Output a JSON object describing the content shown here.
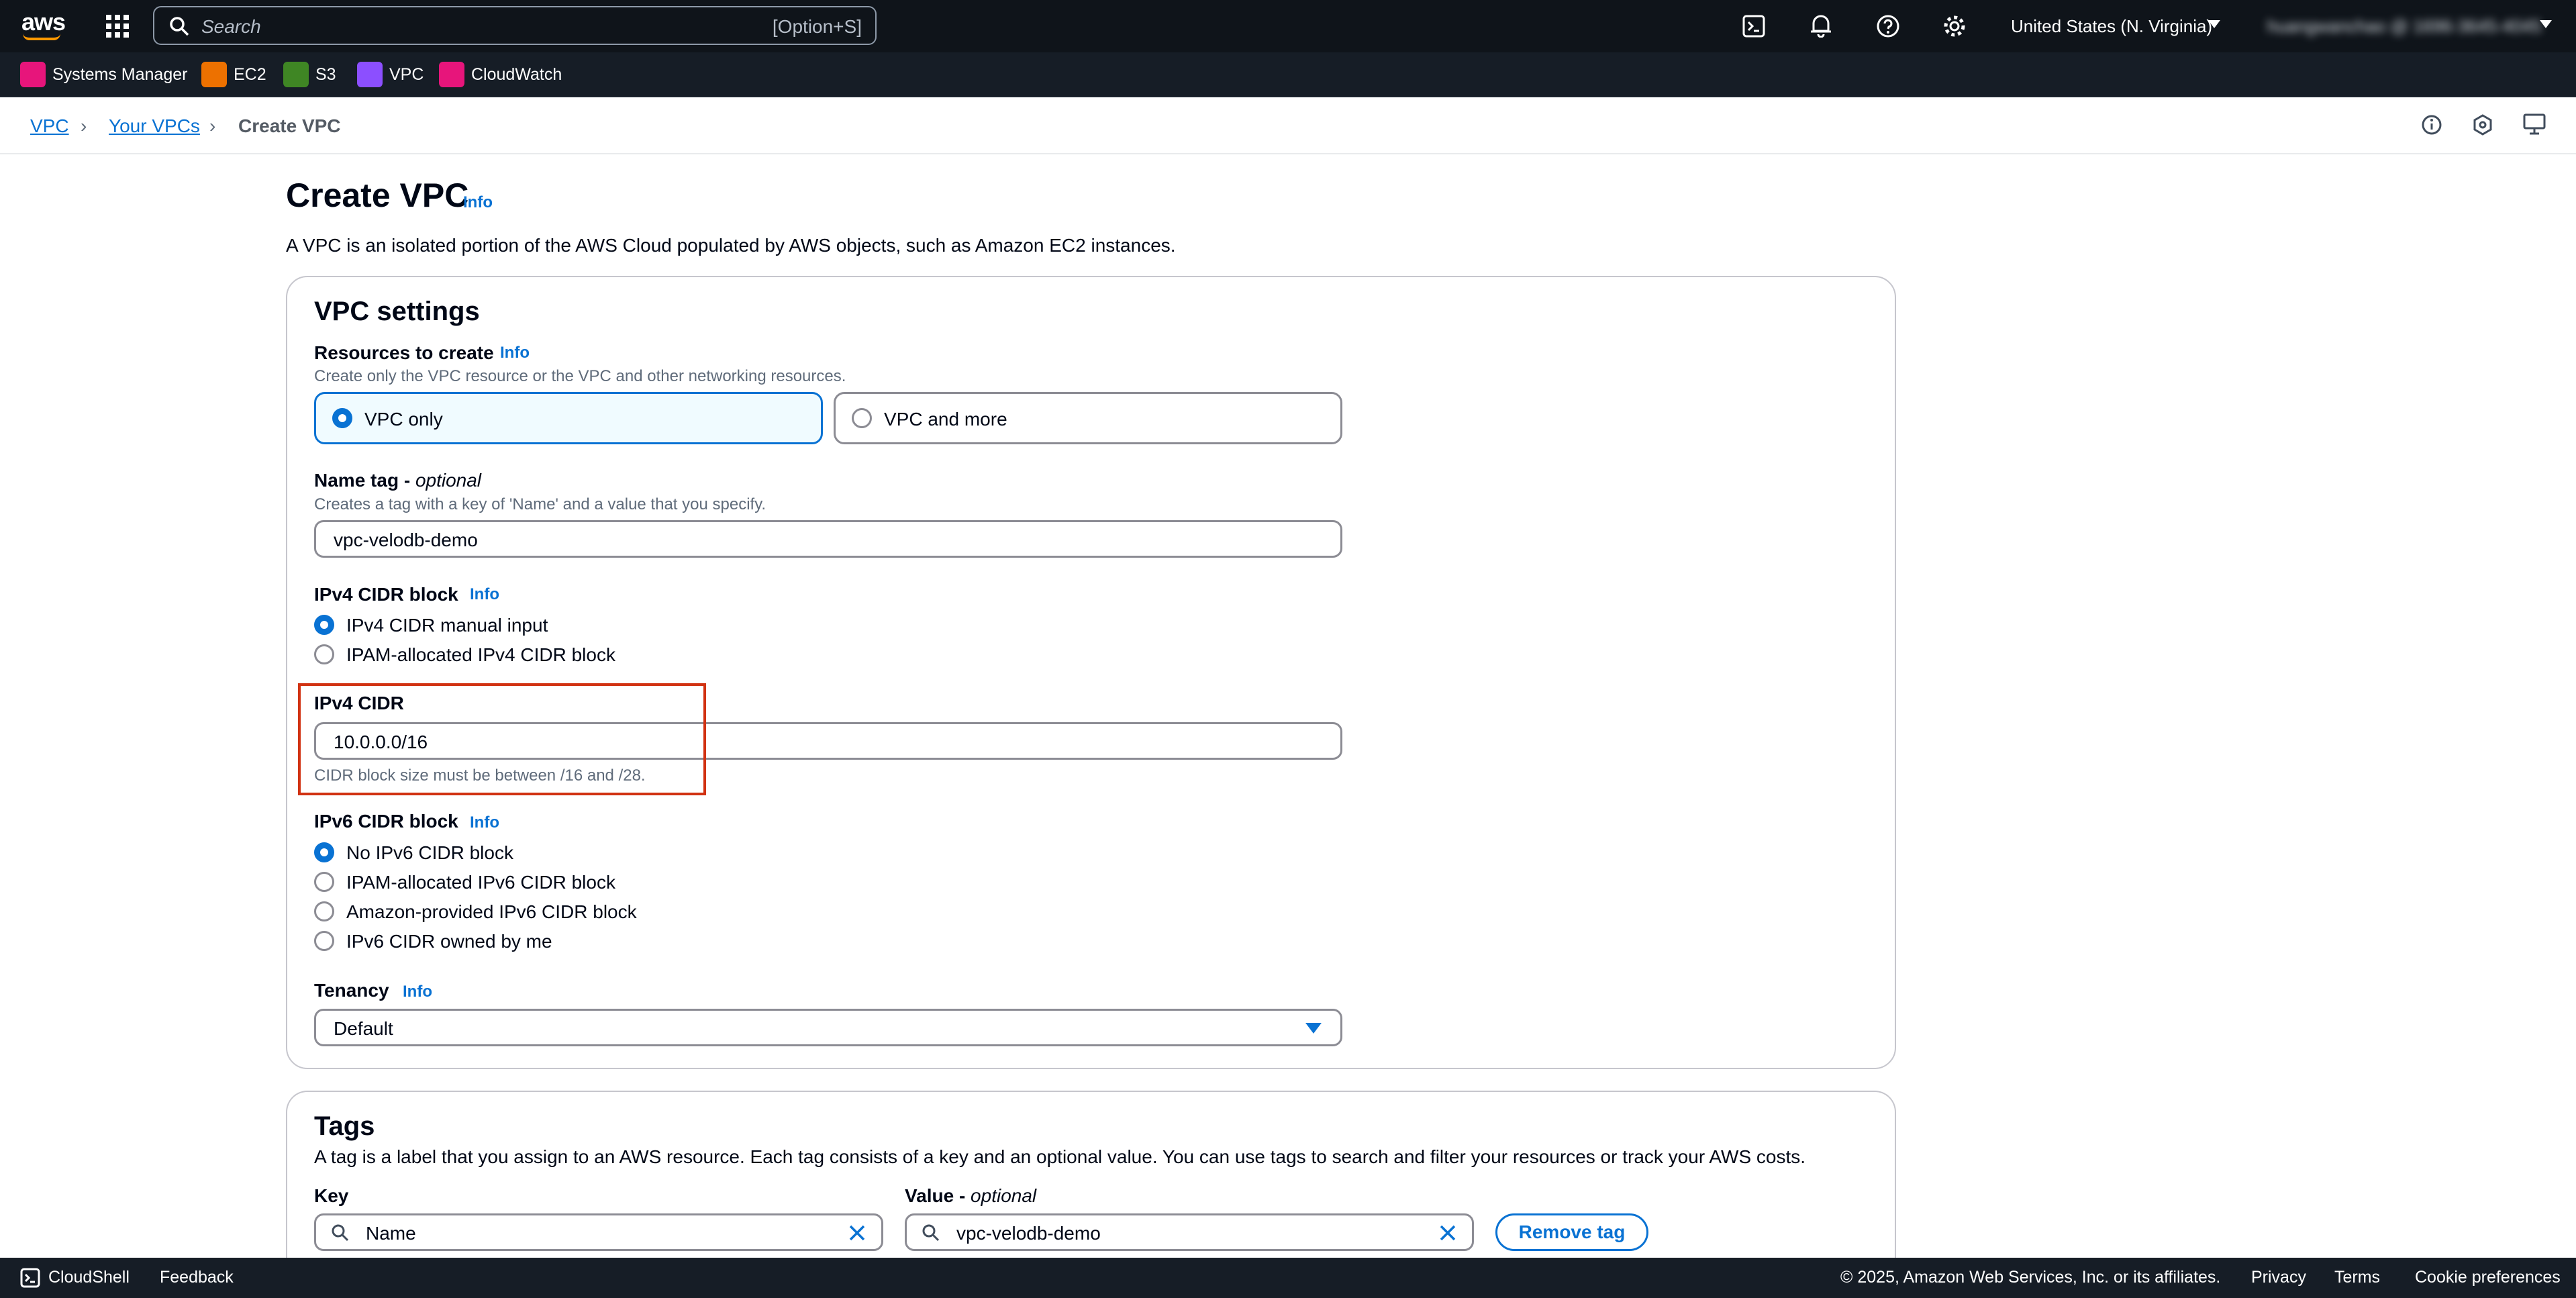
{
  "topnav": {
    "logo": "aws",
    "search_placeholder": "Search",
    "search_shortcut": "[Option+S]",
    "region": "United States (N. Virginia)",
    "account": "huangwanchao @ 1696-3645-4045"
  },
  "services": [
    {
      "label": "Systems Manager",
      "color": "#e7157b"
    },
    {
      "label": "EC2",
      "color": "#ed7100"
    },
    {
      "label": "S3",
      "color": "#3f8624"
    },
    {
      "label": "VPC",
      "color": "#8c4fff"
    },
    {
      "label": "CloudWatch",
      "color": "#e7157b"
    }
  ],
  "breadcrumb": {
    "vpc": "VPC",
    "your_vpcs": "Your VPCs",
    "current": "Create VPC"
  },
  "page": {
    "title": "Create VPC",
    "info": "Info",
    "description": "A VPC is an isolated portion of the AWS Cloud populated by AWS objects, such as Amazon EC2 instances."
  },
  "vpc_settings": {
    "heading": "VPC settings",
    "resources": {
      "label": "Resources to create",
      "info": "Info",
      "hint": "Create only the VPC resource or the VPC and other networking resources.",
      "options": [
        "VPC only",
        "VPC and more"
      ],
      "selected": "VPC only"
    },
    "name_tag": {
      "label": "Name tag - ",
      "optional": "optional",
      "hint": "Creates a tag with a key of 'Name' and a value that you specify.",
      "value": "vpc-velodb-demo"
    },
    "ipv4_block": {
      "label": "IPv4 CIDR block",
      "info": "Info",
      "options": [
        "IPv4 CIDR manual input",
        "IPAM-allocated IPv4 CIDR block"
      ],
      "selected": "IPv4 CIDR manual input"
    },
    "ipv4_cidr": {
      "label": "IPv4 CIDR",
      "value": "10.0.0.0/16",
      "hint": "CIDR block size must be between /16 and /28."
    },
    "ipv6_block": {
      "label": "IPv6 CIDR block",
      "info": "Info",
      "options": [
        "No IPv6 CIDR block",
        "IPAM-allocated IPv6 CIDR block",
        "Amazon-provided IPv6 CIDR block",
        "IPv6 CIDR owned by me"
      ],
      "selected": "No IPv6 CIDR block"
    },
    "tenancy": {
      "label": "Tenancy",
      "info": "Info",
      "value": "Default"
    }
  },
  "tags": {
    "heading": "Tags",
    "description": "A tag is a label that you assign to an AWS resource. Each tag consists of a key and an optional value. You can use tags to search and filter your resources or track your AWS costs.",
    "key_label": "Key",
    "value_label": "Value - ",
    "value_optional": "optional",
    "key_value": "Name",
    "value_value": "vpc-velodb-demo",
    "remove_label": "Remove tag"
  },
  "footer": {
    "cloudshell": "CloudShell",
    "feedback": "Feedback",
    "copyright": "© 2025, Amazon Web Services, Inc. or its affiliates.",
    "privacy": "Privacy",
    "terms": "Terms",
    "cookies": "Cookie preferences"
  }
}
